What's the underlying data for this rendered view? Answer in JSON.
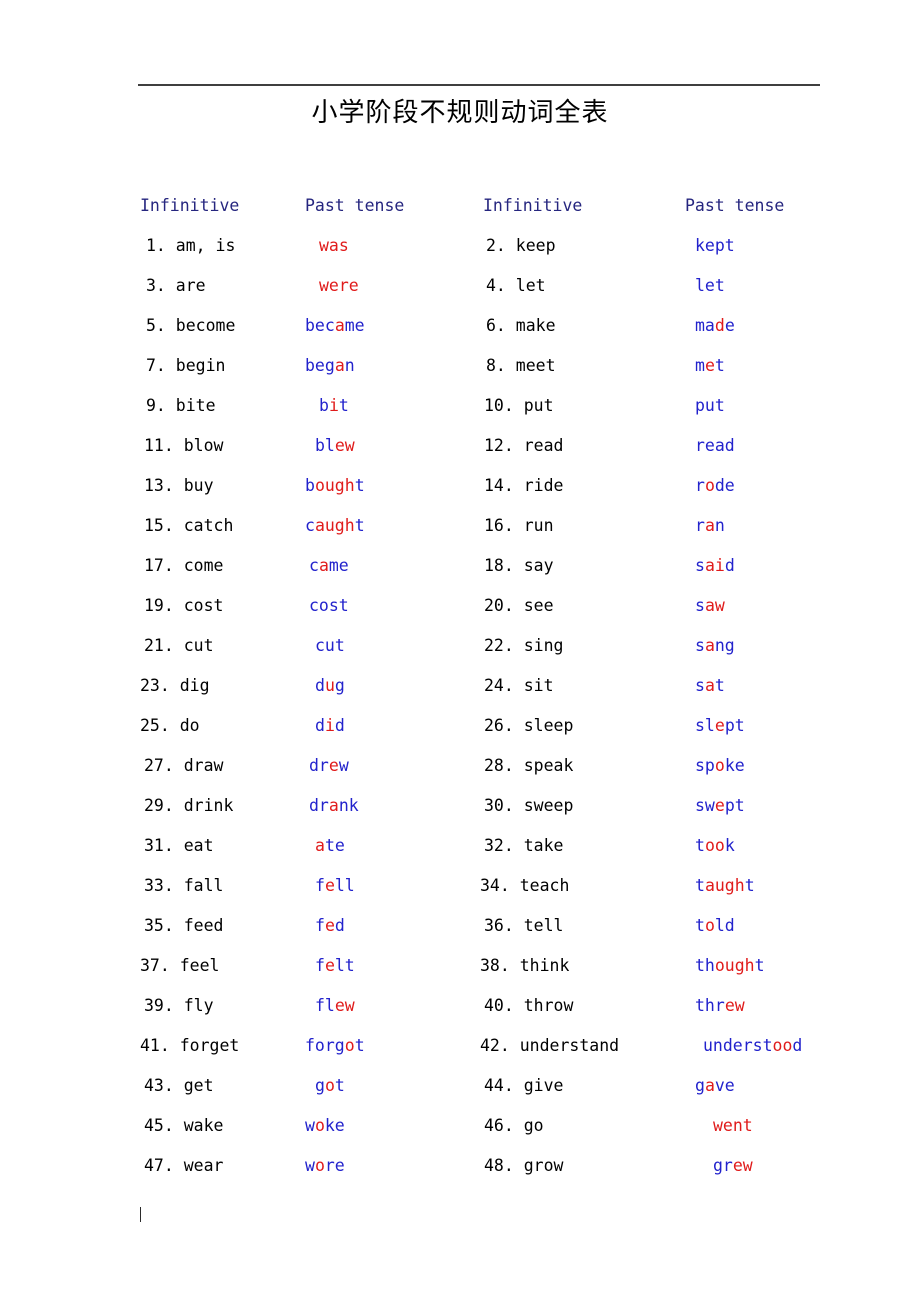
{
  "document": {
    "title": "小学阶段不规则动词全表",
    "headers": [
      "Infinitive",
      "Past tense",
      "Infinitive",
      "Past tense"
    ],
    "colors": {
      "title": "#000000",
      "header": "#26267f",
      "infinitive": "#000000",
      "past_base": "#2222cc",
      "past_highlight": "#e01b1b",
      "rule": "#3f3f3f"
    }
  },
  "rows": [
    {
      "left": {
        "num": "1.",
        "verb": "am, is",
        "indent": 6
      },
      "left_past": {
        "segments": [
          {
            "t": "was",
            "c": "r"
          }
        ],
        "indent": 14
      },
      "right": {
        "num": "2.",
        "verb": "keep",
        "indent": 6
      },
      "right_past": {
        "segments": [
          {
            "t": "kept",
            "c": "b"
          }
        ],
        "indent": 10
      }
    },
    {
      "left": {
        "num": "3.",
        "verb": "are",
        "indent": 6
      },
      "left_past": {
        "segments": [
          {
            "t": "were",
            "c": "r"
          }
        ],
        "indent": 14
      },
      "right": {
        "num": "4.",
        "verb": "let",
        "indent": 6
      },
      "right_past": {
        "segments": [
          {
            "t": "let",
            "c": "b"
          }
        ],
        "indent": 10
      }
    },
    {
      "left": {
        "num": "5.",
        "verb": "become",
        "indent": 6
      },
      "left_past": {
        "segments": [
          {
            "t": "bec",
            "c": "b"
          },
          {
            "t": "a",
            "c": "r"
          },
          {
            "t": "me",
            "c": "b"
          }
        ],
        "indent": 0
      },
      "right": {
        "num": "6.",
        "verb": "make",
        "indent": 6
      },
      "right_past": {
        "segments": [
          {
            "t": "ma",
            "c": "b"
          },
          {
            "t": "d",
            "c": "r"
          },
          {
            "t": "e",
            "c": "b"
          }
        ],
        "indent": 10
      }
    },
    {
      "left": {
        "num": "7.",
        "verb": "begin",
        "indent": 6
      },
      "left_past": {
        "segments": [
          {
            "t": "beg",
            "c": "b"
          },
          {
            "t": "a",
            "c": "r"
          },
          {
            "t": "n",
            "c": "b"
          }
        ],
        "indent": 0
      },
      "right": {
        "num": "8.",
        "verb": "meet",
        "indent": 6
      },
      "right_past": {
        "segments": [
          {
            "t": "m",
            "c": "b"
          },
          {
            "t": "e",
            "c": "r"
          },
          {
            "t": "t",
            "c": "b"
          }
        ],
        "indent": 10
      }
    },
    {
      "left": {
        "num": "9.",
        "verb": "bite",
        "indent": 6
      },
      "left_past": {
        "segments": [
          {
            "t": "b",
            "c": "b"
          },
          {
            "t": "i",
            "c": "r"
          },
          {
            "t": "t",
            "c": "b"
          }
        ],
        "indent": 14
      },
      "right": {
        "num": "10.",
        "verb": "put",
        "indent": 4
      },
      "right_past": {
        "segments": [
          {
            "t": "put",
            "c": "b"
          }
        ],
        "indent": 10
      }
    },
    {
      "left": {
        "num": "11.",
        "verb": "blow",
        "indent": 4
      },
      "left_past": {
        "segments": [
          {
            "t": "bl",
            "c": "b"
          },
          {
            "t": "ew",
            "c": "r"
          }
        ],
        "indent": 10
      },
      "right": {
        "num": "12.",
        "verb": "read",
        "indent": 4
      },
      "right_past": {
        "segments": [
          {
            "t": "read",
            "c": "b"
          }
        ],
        "indent": 10
      }
    },
    {
      "left": {
        "num": "13.",
        "verb": "buy",
        "indent": 4
      },
      "left_past": {
        "segments": [
          {
            "t": "b",
            "c": "b"
          },
          {
            "t": "ough",
            "c": "r"
          },
          {
            "t": "t",
            "c": "b"
          }
        ],
        "indent": 0
      },
      "right": {
        "num": "14.",
        "verb": "ride",
        "indent": 4
      },
      "right_past": {
        "segments": [
          {
            "t": "r",
            "c": "b"
          },
          {
            "t": "o",
            "c": "r"
          },
          {
            "t": "de",
            "c": "b"
          }
        ],
        "indent": 10
      }
    },
    {
      "left": {
        "num": "15.",
        "verb": "catch",
        "indent": 4
      },
      "left_past": {
        "segments": [
          {
            "t": "c",
            "c": "b"
          },
          {
            "t": "augh",
            "c": "r"
          },
          {
            "t": "t",
            "c": "b"
          }
        ],
        "indent": 0
      },
      "right": {
        "num": "16.",
        "verb": "run",
        "indent": 4
      },
      "right_past": {
        "segments": [
          {
            "t": "r",
            "c": "b"
          },
          {
            "t": "a",
            "c": "r"
          },
          {
            "t": "n",
            "c": "b"
          }
        ],
        "indent": 10
      }
    },
    {
      "left": {
        "num": "17.",
        "verb": "come",
        "indent": 4
      },
      "left_past": {
        "segments": [
          {
            "t": "c",
            "c": "b"
          },
          {
            "t": "a",
            "c": "r"
          },
          {
            "t": "me",
            "c": "b"
          }
        ],
        "indent": 4
      },
      "right": {
        "num": "18.",
        "verb": "say",
        "indent": 4
      },
      "right_past": {
        "segments": [
          {
            "t": "s",
            "c": "b"
          },
          {
            "t": "ai",
            "c": "r"
          },
          {
            "t": "d",
            "c": "b"
          }
        ],
        "indent": 10
      }
    },
    {
      "left": {
        "num": "19.",
        "verb": "cost",
        "indent": 4
      },
      "left_past": {
        "segments": [
          {
            "t": "cost",
            "c": "b"
          }
        ],
        "indent": 4
      },
      "right": {
        "num": "20.",
        "verb": "see",
        "indent": 4
      },
      "right_past": {
        "segments": [
          {
            "t": "s",
            "c": "b"
          },
          {
            "t": "aw",
            "c": "r"
          }
        ],
        "indent": 10
      }
    },
    {
      "left": {
        "num": "21.",
        "verb": "cut",
        "indent": 4
      },
      "left_past": {
        "segments": [
          {
            "t": "cut",
            "c": "b"
          }
        ],
        "indent": 10
      },
      "right": {
        "num": "22.",
        "verb": "sing",
        "indent": 4
      },
      "right_past": {
        "segments": [
          {
            "t": "s",
            "c": "b"
          },
          {
            "t": "a",
            "c": "r"
          },
          {
            "t": "ng",
            "c": "b"
          }
        ],
        "indent": 10
      }
    },
    {
      "left": {
        "num": "23.",
        "verb": "dig",
        "indent": 0
      },
      "left_past": {
        "segments": [
          {
            "t": "d",
            "c": "b"
          },
          {
            "t": "u",
            "c": "r"
          },
          {
            "t": "g",
            "c": "b"
          }
        ],
        "indent": 10
      },
      "right": {
        "num": "24.",
        "verb": "sit",
        "indent": 4
      },
      "right_past": {
        "segments": [
          {
            "t": "s",
            "c": "b"
          },
          {
            "t": "a",
            "c": "r"
          },
          {
            "t": "t",
            "c": "b"
          }
        ],
        "indent": 10
      }
    },
    {
      "left": {
        "num": "25.",
        "verb": "do",
        "indent": 0
      },
      "left_past": {
        "segments": [
          {
            "t": "d",
            "c": "b"
          },
          {
            "t": "i",
            "c": "r"
          },
          {
            "t": "d",
            "c": "b"
          }
        ],
        "indent": 10
      },
      "right": {
        "num": "26.",
        "verb": "sleep",
        "indent": 4
      },
      "right_past": {
        "segments": [
          {
            "t": "sl",
            "c": "b"
          },
          {
            "t": "e",
            "c": "r"
          },
          {
            "t": "pt",
            "c": "b"
          }
        ],
        "indent": 10
      }
    },
    {
      "left": {
        "num": "27.",
        "verb": "draw",
        "indent": 4
      },
      "left_past": {
        "segments": [
          {
            "t": "dr",
            "c": "b"
          },
          {
            "t": "e",
            "c": "r"
          },
          {
            "t": "w",
            "c": "b"
          }
        ],
        "indent": 4
      },
      "right": {
        "num": "28.",
        "verb": "speak",
        "indent": 4
      },
      "right_past": {
        "segments": [
          {
            "t": "sp",
            "c": "b"
          },
          {
            "t": "o",
            "c": "r"
          },
          {
            "t": "ke",
            "c": "b"
          }
        ],
        "indent": 10
      }
    },
    {
      "left": {
        "num": "29.",
        "verb": "drink",
        "indent": 4
      },
      "left_past": {
        "segments": [
          {
            "t": "dr",
            "c": "b"
          },
          {
            "t": "a",
            "c": "r"
          },
          {
            "t": "nk",
            "c": "b"
          }
        ],
        "indent": 4
      },
      "right": {
        "num": "30.",
        "verb": "sweep",
        "indent": 4
      },
      "right_past": {
        "segments": [
          {
            "t": "sw",
            "c": "b"
          },
          {
            "t": "e",
            "c": "r"
          },
          {
            "t": "pt",
            "c": "b"
          }
        ],
        "indent": 10
      }
    },
    {
      "left": {
        "num": "31.",
        "verb": "eat",
        "indent": 4
      },
      "left_past": {
        "segments": [
          {
            "t": "a",
            "c": "r"
          },
          {
            "t": "te",
            "c": "b"
          }
        ],
        "indent": 10
      },
      "right": {
        "num": "32.",
        "verb": "take",
        "indent": 4
      },
      "right_past": {
        "segments": [
          {
            "t": "t",
            "c": "b"
          },
          {
            "t": "oo",
            "c": "r"
          },
          {
            "t": "k",
            "c": "b"
          }
        ],
        "indent": 10
      }
    },
    {
      "left": {
        "num": "33.",
        "verb": "fall",
        "indent": 4
      },
      "left_past": {
        "segments": [
          {
            "t": "f",
            "c": "b"
          },
          {
            "t": "e",
            "c": "r"
          },
          {
            "t": "ll",
            "c": "b"
          }
        ],
        "indent": 10
      },
      "right": {
        "num": "34.",
        "verb": "teach",
        "indent": 0
      },
      "right_past": {
        "segments": [
          {
            "t": "t",
            "c": "b"
          },
          {
            "t": "augh",
            "c": "r"
          },
          {
            "t": "t",
            "c": "b"
          }
        ],
        "indent": 10
      }
    },
    {
      "left": {
        "num": "35.",
        "verb": "feed",
        "indent": 4
      },
      "left_past": {
        "segments": [
          {
            "t": "f",
            "c": "b"
          },
          {
            "t": "e",
            "c": "r"
          },
          {
            "t": "d",
            "c": "b"
          }
        ],
        "indent": 10
      },
      "right": {
        "num": "36.",
        "verb": "tell",
        "indent": 4
      },
      "right_past": {
        "segments": [
          {
            "t": "t",
            "c": "b"
          },
          {
            "t": "o",
            "c": "r"
          },
          {
            "t": "ld",
            "c": "b"
          }
        ],
        "indent": 10
      }
    },
    {
      "left": {
        "num": "37.",
        "verb": "feel",
        "indent": 0
      },
      "left_past": {
        "segments": [
          {
            "t": "f",
            "c": "b"
          },
          {
            "t": "e",
            "c": "r"
          },
          {
            "t": "lt",
            "c": "b"
          }
        ],
        "indent": 10
      },
      "right": {
        "num": "38.",
        "verb": "think",
        "indent": 0
      },
      "right_past": {
        "segments": [
          {
            "t": "th",
            "c": "b"
          },
          {
            "t": "ough",
            "c": "r"
          },
          {
            "t": "t",
            "c": "b"
          }
        ],
        "indent": 10
      }
    },
    {
      "left": {
        "num": "39.",
        "verb": "fly",
        "indent": 4
      },
      "left_past": {
        "segments": [
          {
            "t": "fl",
            "c": "b"
          },
          {
            "t": "ew",
            "c": "r"
          }
        ],
        "indent": 10
      },
      "right": {
        "num": "40.",
        "verb": "throw",
        "indent": 4
      },
      "right_past": {
        "segments": [
          {
            "t": "thr",
            "c": "b"
          },
          {
            "t": "ew",
            "c": "r"
          }
        ],
        "indent": 10
      }
    },
    {
      "left": {
        "num": "41.",
        "verb": "forget",
        "indent": 0
      },
      "left_past": {
        "segments": [
          {
            "t": "forg",
            "c": "b"
          },
          {
            "t": "o",
            "c": "r"
          },
          {
            "t": "t",
            "c": "b"
          }
        ],
        "indent": 0
      },
      "right": {
        "num": "42.",
        "verb": "understand",
        "indent": 0
      },
      "right_past": {
        "segments": [
          {
            "t": "underst",
            "c": "b"
          },
          {
            "t": "oo",
            "c": "r"
          },
          {
            "t": "d",
            "c": "b"
          }
        ],
        "indent": 18
      }
    },
    {
      "left": {
        "num": "43.",
        "verb": "get",
        "indent": 4
      },
      "left_past": {
        "segments": [
          {
            "t": "g",
            "c": "b"
          },
          {
            "t": "o",
            "c": "r"
          },
          {
            "t": "t",
            "c": "b"
          }
        ],
        "indent": 10
      },
      "right": {
        "num": "44.",
        "verb": "give",
        "indent": 4
      },
      "right_past": {
        "segments": [
          {
            "t": "g",
            "c": "b"
          },
          {
            "t": "a",
            "c": "r"
          },
          {
            "t": "ve",
            "c": "b"
          }
        ],
        "indent": 10
      }
    },
    {
      "left": {
        "num": "45.",
        "verb": "wake",
        "indent": 4
      },
      "left_past": {
        "segments": [
          {
            "t": "w",
            "c": "b"
          },
          {
            "t": "o",
            "c": "r"
          },
          {
            "t": "ke",
            "c": "b"
          }
        ],
        "indent": 0
      },
      "right": {
        "num": "46.",
        "verb": "go",
        "indent": 4
      },
      "right_past": {
        "segments": [
          {
            "t": "went",
            "c": "r"
          }
        ],
        "indent": 28
      }
    },
    {
      "left": {
        "num": "47.",
        "verb": "wear",
        "indent": 4
      },
      "left_past": {
        "segments": [
          {
            "t": "w",
            "c": "b"
          },
          {
            "t": "o",
            "c": "r"
          },
          {
            "t": "re",
            "c": "b"
          }
        ],
        "indent": 0
      },
      "right": {
        "num": "48.",
        "verb": "grow",
        "indent": 4
      },
      "right_past": {
        "segments": [
          {
            "t": "gr",
            "c": "b"
          },
          {
            "t": "ew",
            "c": "r"
          }
        ],
        "indent": 28
      }
    }
  ]
}
